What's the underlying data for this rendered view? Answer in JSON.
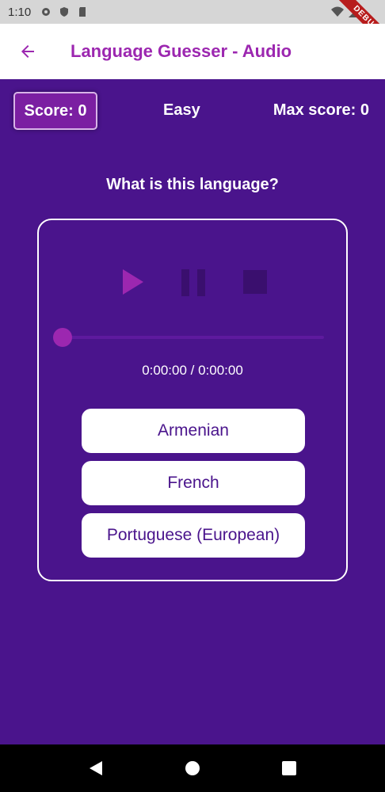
{
  "status_bar": {
    "time": "1:10",
    "debug_banner": "DEBUG"
  },
  "app_bar": {
    "title": "Language Guesser - Audio"
  },
  "scoreboard": {
    "score": "Score: 0",
    "difficulty": "Easy",
    "max_score": "Max score: 0"
  },
  "question": "What is this language?",
  "player": {
    "time_readout": "0:00:00 / 0:00:00",
    "progress": 0
  },
  "answers": [
    {
      "label": "Armenian"
    },
    {
      "label": "French"
    },
    {
      "label": "Portuguese (European)"
    }
  ],
  "colors": {
    "background": "#4a148c",
    "accent": "#9c27b0",
    "app_bar": "#ffffff"
  },
  "icons": [
    "back-arrow-icon",
    "play-icon",
    "pause-icon",
    "stop-icon",
    "nav-back-icon",
    "nav-home-icon",
    "nav-recents-icon"
  ]
}
